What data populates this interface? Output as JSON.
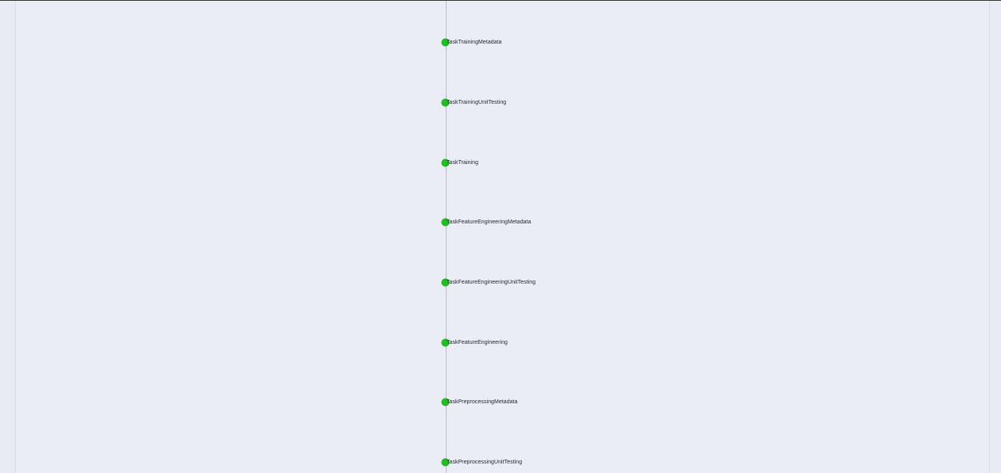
{
  "graph": {
    "node_color": "#1ec21e",
    "edge_color": "#b8bec8",
    "background": "#eaeef4",
    "nodes": [
      {
        "label": "TaskTrainingMetadata",
        "status": "success"
      },
      {
        "label": "TaskTrainingUnitTesting",
        "status": "success"
      },
      {
        "label": "TaskTraining",
        "status": "success"
      },
      {
        "label": "TaskFeatureEngineeringMetadata",
        "status": "success"
      },
      {
        "label": "TaskFeatureEngineeringUnitTesting",
        "status": "success"
      },
      {
        "label": "TaskFeatureEngineering",
        "status": "success"
      },
      {
        "label": "TaskPreprocessingMetadata",
        "status": "success"
      },
      {
        "label": "TaskPreprocessingUnitTesting",
        "status": "success"
      }
    ]
  }
}
